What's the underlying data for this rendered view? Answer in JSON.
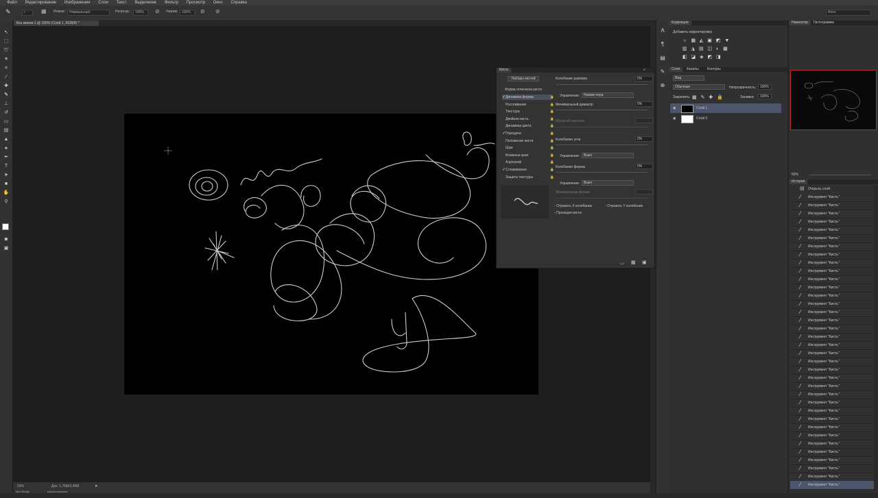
{
  "menubar": [
    "Файл",
    "Редактирование",
    "Изображение",
    "Слои",
    "Текст",
    "Выделение",
    "Фильтр",
    "Просмотр",
    "Окно",
    "Справка"
  ],
  "optbar": {
    "mode_label": "Режим:",
    "mode_value": "Нормальный",
    "opacity_label": "Непрозр.:",
    "opacity_value": "100%",
    "flow_label": "Нажим:",
    "flow_value": "100%",
    "workspace": "Фото"
  },
  "doc_tab": "Без имени-1 @ 100% (Слой 1, RGB/8) *",
  "status": {
    "zoom": "50%",
    "doc": "Док: 1,76M/3,49M"
  },
  "bottom_tabs": [
    "Mini Bridge",
    "Шкала времени"
  ],
  "right_top": {
    "adjustments_tab": "Коррекция",
    "adjustments_subtitle": "Добавить корректировку"
  },
  "layers_panel": {
    "tabs": [
      "Слои",
      "Каналы",
      "Контуры"
    ],
    "kind": "Вид",
    "blend_mode": "Обычные",
    "opacity_label": "Непрозрачность:",
    "opacity_value": "100%",
    "lock_label": "Закрепить:",
    "fill_label": "Заливка:",
    "fill_value": "100%",
    "layers": [
      {
        "name": "Слой 1",
        "selected": true
      },
      {
        "name": "Слой 0",
        "selected": false
      }
    ]
  },
  "navigator": {
    "tabs": [
      "Навигатор",
      "Гистограмма"
    ],
    "zoom": "50%"
  },
  "history": {
    "title": "История",
    "first": "Открыть слой",
    "brush_label": "Инструмент \"Кисть\"",
    "count": 36
  },
  "brush_panel": {
    "tabs": [
      "Кисть",
      "Наборы кистей"
    ],
    "presets_button": "Наборы кистей",
    "section_title": "Форма отпечатка кисти",
    "options": [
      {
        "name": "Динамика формы",
        "checked": true,
        "selected": true
      },
      {
        "name": "Рассеивание",
        "checked": false,
        "selected": false
      },
      {
        "name": "Текстура",
        "checked": false,
        "selected": false
      },
      {
        "name": "Двойная кисть",
        "checked": false,
        "selected": false
      },
      {
        "name": "Динамика цвета",
        "checked": false,
        "selected": false
      },
      {
        "name": "Передача",
        "checked": true,
        "selected": false
      },
      {
        "name": "Положение кисти",
        "checked": false,
        "selected": false
      },
      {
        "name": "Шум",
        "checked": false,
        "selected": false
      },
      {
        "name": "Влажные края",
        "checked": false,
        "selected": false
      },
      {
        "name": "Аэрограф",
        "checked": false,
        "selected": false
      },
      {
        "name": "Сглаживание",
        "checked": true,
        "selected": false
      },
      {
        "name": "Защита текстуры",
        "checked": false,
        "selected": false
      }
    ],
    "size_jitter_label": "Колебание размера",
    "size_jitter_value": "0%",
    "control_label": "Управление:",
    "control_value1": "Нажим пера",
    "min_diameter_label": "Минимальный диаметр",
    "min_diameter_value": "0%",
    "tilt_scale_label": "Масштаб наклона",
    "angle_jitter_label": "Колебание угла",
    "angle_jitter_value": "0%",
    "control_value2": "Выкл",
    "roundness_jitter_label": "Колебание формы",
    "roundness_jitter_value": "0%",
    "control_value3": "Выкл",
    "min_roundness_label": "Минимальная форма",
    "flip_x": "Отразить X колебание",
    "flip_y": "Отразить Y колебание",
    "brush_projection": "Проекция кисти"
  }
}
